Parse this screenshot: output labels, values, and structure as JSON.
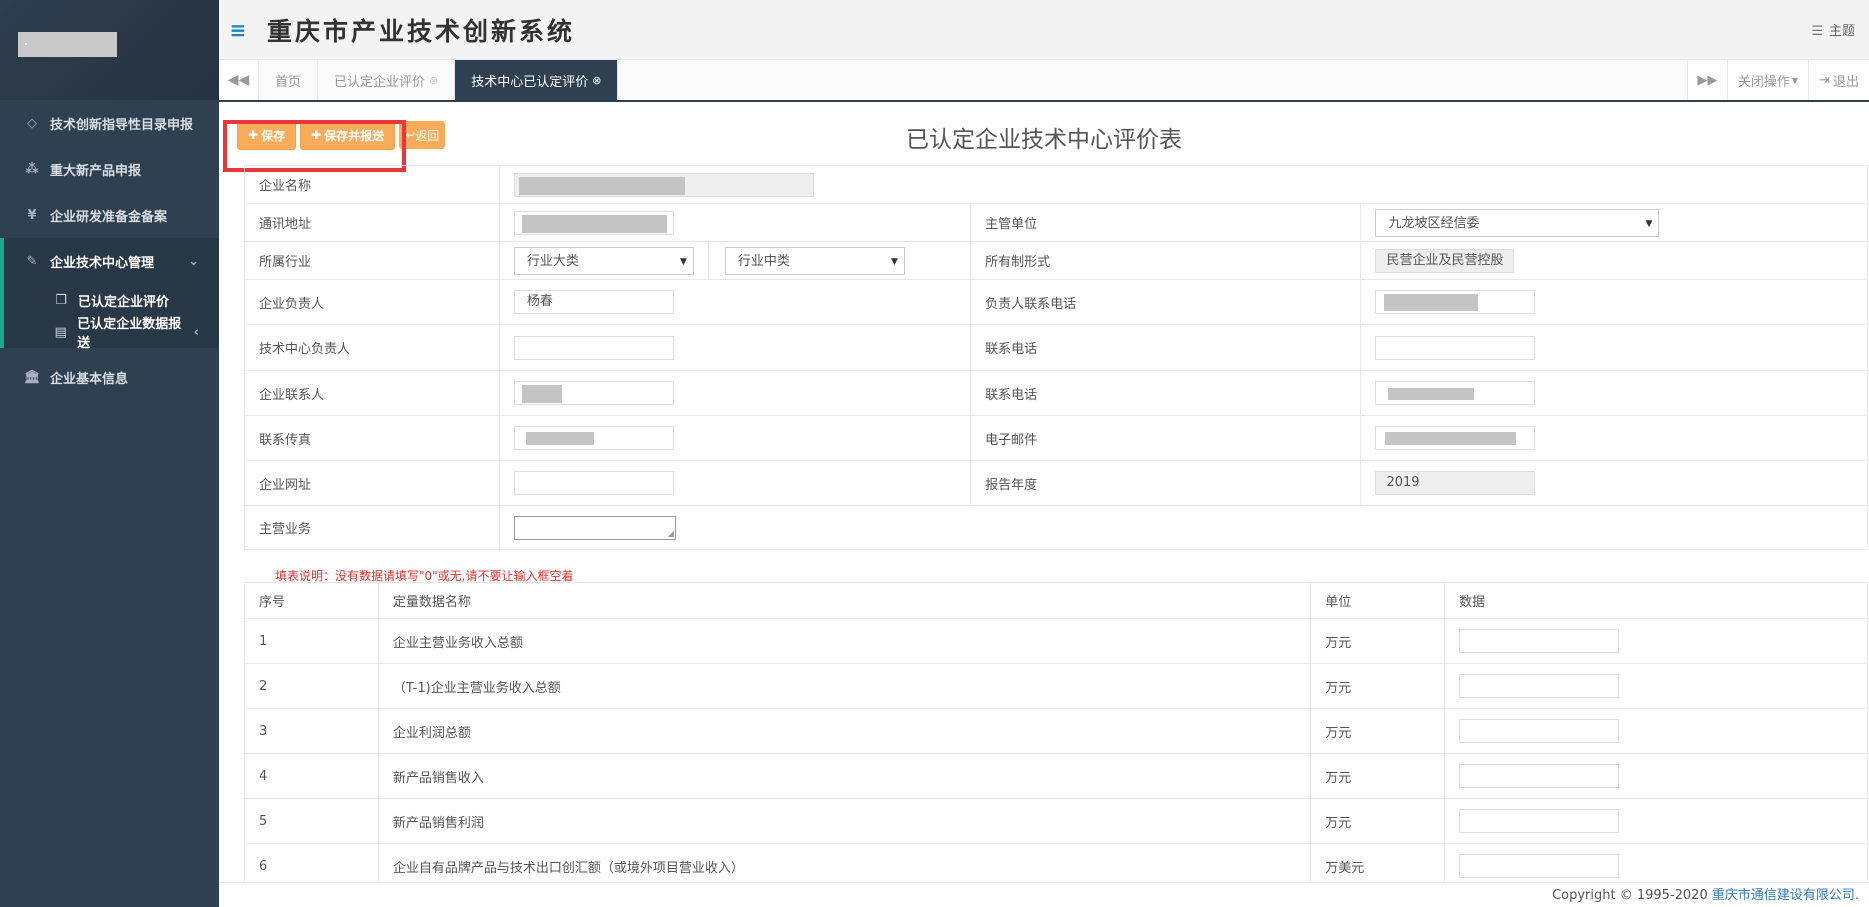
{
  "app": {
    "title": "重庆市产业技术创新系统",
    "theme_label": "主题"
  },
  "sidebar": {
    "items": [
      {
        "label": "技术创新指导性目录申报",
        "icon": "diamond-icon"
      },
      {
        "label": "重大新产品申报",
        "icon": "cubes-icon"
      },
      {
        "label": "企业研发准备金备案",
        "icon": "yen-icon"
      },
      {
        "label": "企业技术中心管理",
        "icon": "edit-icon"
      },
      {
        "label": "企业基本信息",
        "icon": "bank-icon"
      }
    ],
    "subitems": [
      {
        "label": "已认定企业评价",
        "icon": "copy-icon"
      },
      {
        "label": "已认定企业数据报送",
        "icon": "file-icon"
      }
    ]
  },
  "tabs": {
    "items": [
      {
        "label": "首页"
      },
      {
        "label": "已认定企业评价"
      },
      {
        "label": "技术中心已认定评价"
      }
    ],
    "close_ops_label": "关闭操作",
    "logout_label": "退出"
  },
  "toolbar": {
    "save_label": "保存",
    "save_report_label": "保存并报送",
    "back_label": "返回"
  },
  "form": {
    "title": "已认定企业技术中心评价表",
    "labels": {
      "company_name": "企业名称",
      "address": "通讯地址",
      "supervisor": "主管单位",
      "industry": "所属行业",
      "ownership": "所有制形式",
      "legal_person": "企业负责人",
      "legal_phone": "负责人联系电话",
      "center_head": "技术中心负责人",
      "center_phone": "联系电话",
      "contact": "企业联系人",
      "contact_phone": "联系电话",
      "fax": "联系传真",
      "email": "电子邮件",
      "website": "企业网址",
      "report_year": "报告年度",
      "main_business": "主营业务"
    },
    "values": {
      "supervisor": "九龙坡区经信委",
      "industry_major": "行业大类",
      "industry_mid": "行业中类",
      "ownership": "民营企业及民营控股",
      "legal_person": "杨春",
      "report_year": "2019"
    }
  },
  "note": "填表说明：没有数据请填写\"0\"或无,请不要让输入框空着",
  "data_table": {
    "headers": {
      "no": "序号",
      "name": "定量数据名称",
      "unit": "单位",
      "value": "数据"
    },
    "rows": [
      {
        "no": "1",
        "name": "企业主营业务收入总额",
        "unit": "万元"
      },
      {
        "no": "2",
        "name": "（T-1)企业主营业务收入总额",
        "unit": "万元"
      },
      {
        "no": "3",
        "name": "企业利润总额",
        "unit": "万元"
      },
      {
        "no": "4",
        "name": "新产品销售收入",
        "unit": "万元"
      },
      {
        "no": "5",
        "name": "新产品销售利润",
        "unit": "万元"
      },
      {
        "no": "6",
        "name": "企业自有品牌产品与技术出口创汇额（或境外项目营业收入）",
        "unit": "万美元"
      }
    ]
  },
  "footer": {
    "copyright": "Copyright © 1995-2020 ",
    "company": "重庆市通信建设有限公司."
  }
}
